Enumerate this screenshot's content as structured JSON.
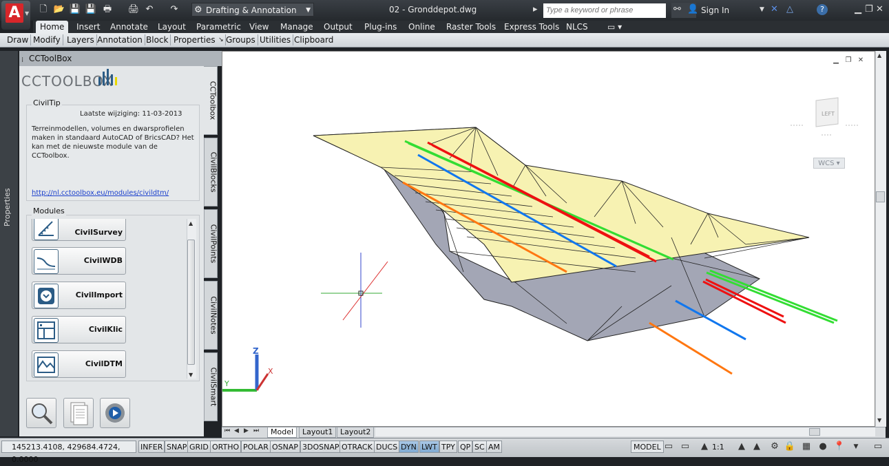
{
  "titlebar": {
    "workspace": "Drafting & Annotation",
    "document_title": "02 - Gronddepot.dwg",
    "search_placeholder": "Type a keyword or phrase",
    "sign_in": "Sign In"
  },
  "ribbon": {
    "tabs": [
      "Home",
      "Insert",
      "Annotate",
      "Layout",
      "Parametric",
      "View",
      "Manage",
      "Output",
      "Plug-ins",
      "Online",
      "Raster Tools",
      "Express Tools",
      "NLCS"
    ],
    "active_tab": "Home",
    "panels": [
      "Draw",
      "Modify",
      "Layers",
      "Annotation",
      "Block",
      "Properties",
      "Groups",
      "Utilities",
      "Clipboard"
    ]
  },
  "side_strip": {
    "label": "Properties"
  },
  "palette": {
    "title": "CCToolBox",
    "logo_text": "CCTOOLBOX",
    "civiltip": {
      "label": "CivilTip",
      "date": "Laatste wijziging: 11-03-2013",
      "text": "Terreinmodellen, volumes en dwarsprofielen maken in standaard AutoCAD of BricsCAD? Het kan met de nieuwste module van de CCToolbox.",
      "link": "http://nl.cctoolbox.eu/modules/civildtm/"
    },
    "modules_label": "Modules",
    "modules": [
      "CivilSurvey",
      "CivilWDB",
      "CivilImport",
      "CivilKlic",
      "CivilDTM"
    ],
    "vertical_tabs": [
      "CCToolbox",
      "CivilBlocks",
      "CivilPoints",
      "CivilNotes",
      "CivilSmart"
    ]
  },
  "viewport": {
    "viewcube_face": "LEFT",
    "ucs_label": "WCS",
    "axis_labels": {
      "x": "X",
      "y": "Y",
      "z": "Z"
    },
    "line_colors": {
      "green": "#33dd33",
      "red": "#ee1111",
      "blue": "#1177ee",
      "orange": "#ff7711",
      "fill": "#f7f2b2",
      "side": "#a3a6b5"
    }
  },
  "layout_tabs": [
    "Model",
    "Layout1",
    "Layout2"
  ],
  "status": {
    "coords": "145213.4108, 429684.4724, 0.0000",
    "toggles": [
      "INFER",
      "SNAP",
      "GRID",
      "ORTHO",
      "POLAR",
      "OSNAP",
      "3DOSNAP",
      "OTRACK",
      "DUCS",
      "DYN",
      "LWT",
      "TPY",
      "QP",
      "SC",
      "AM"
    ],
    "model": "MODEL",
    "scale": "1:1"
  }
}
